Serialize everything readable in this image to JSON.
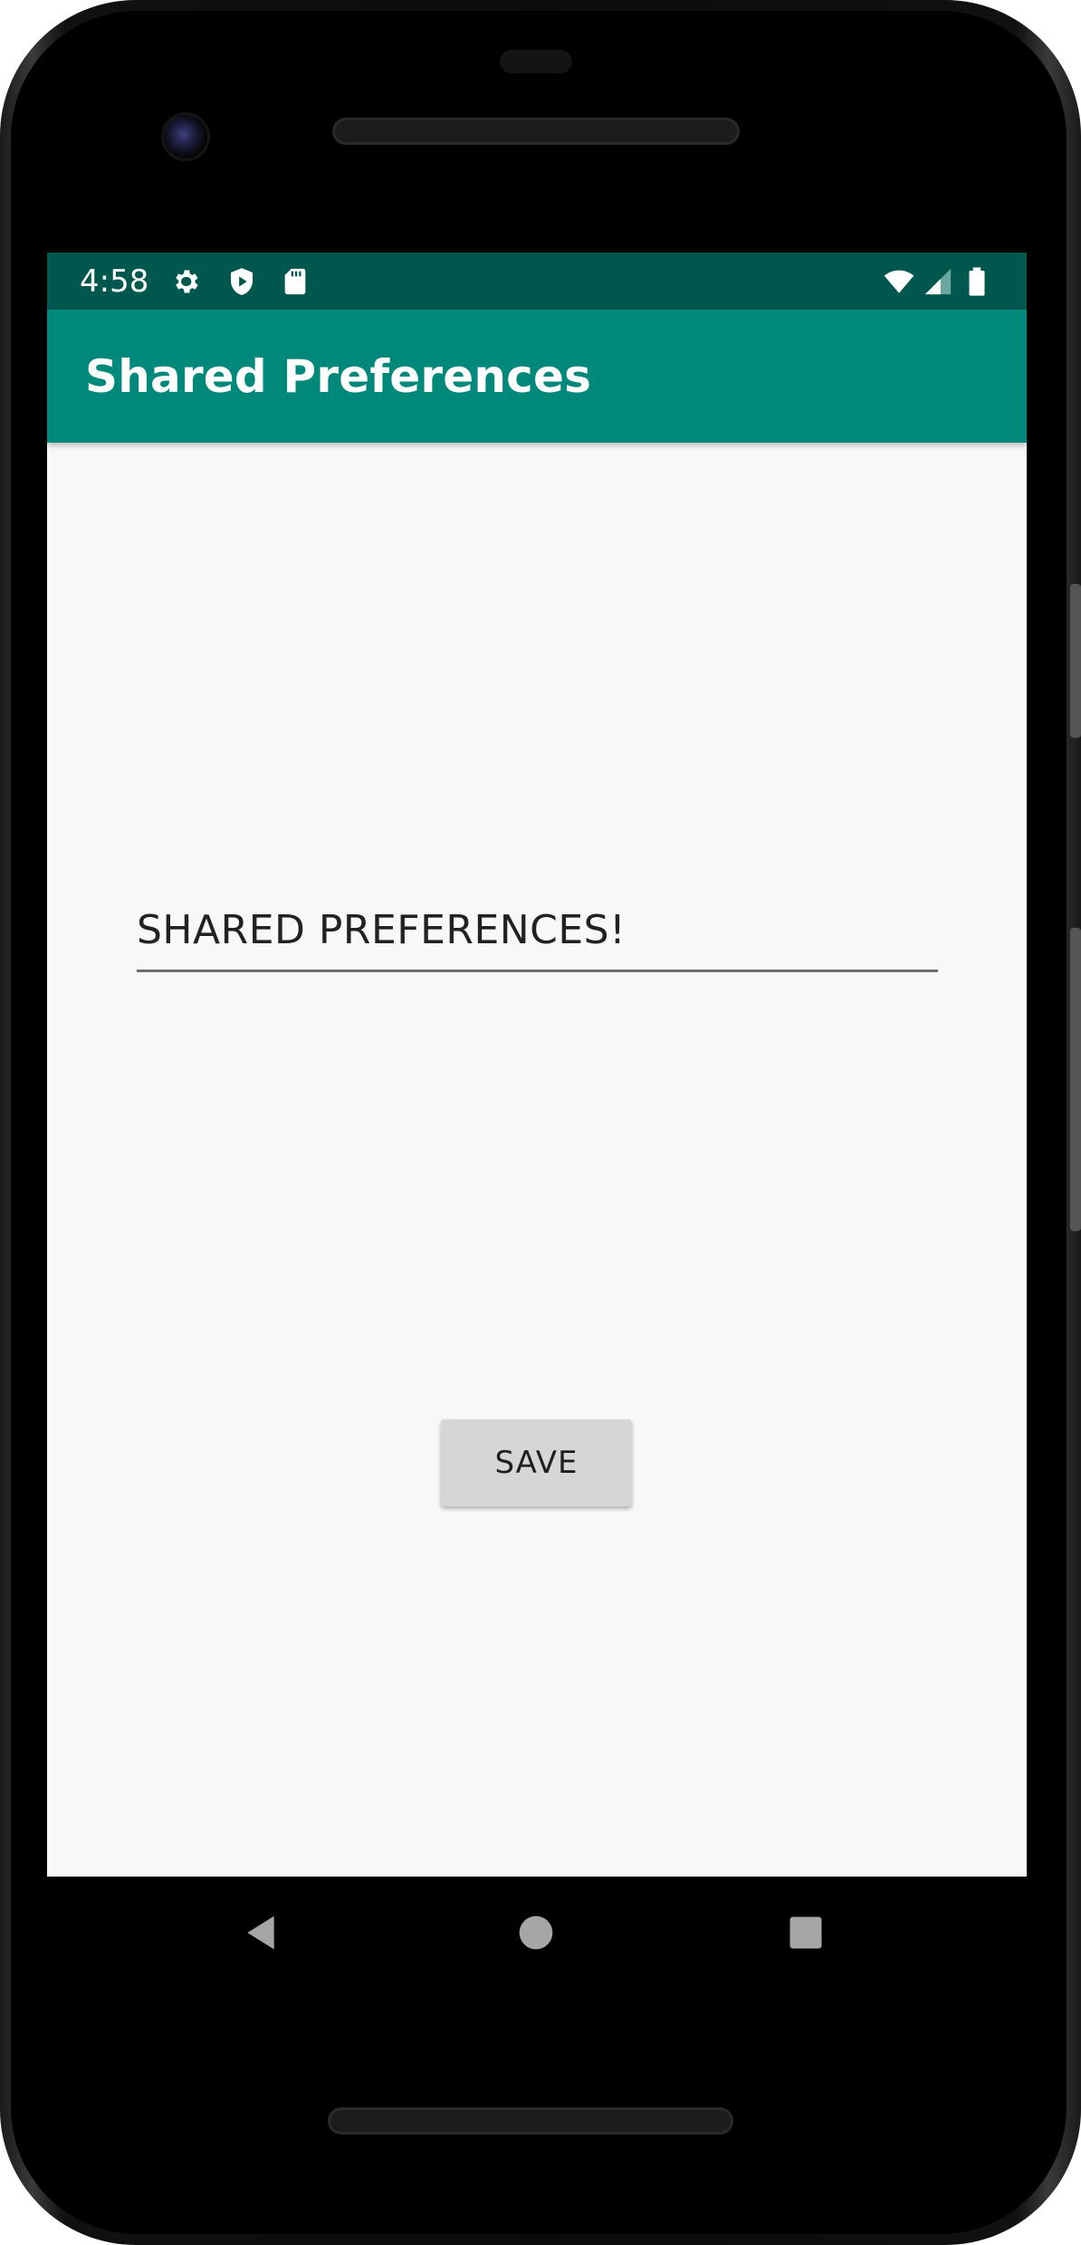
{
  "status_bar": {
    "time": "4:58",
    "left_icons": [
      "gear-icon",
      "shield-play-icon",
      "sd-card-icon"
    ],
    "right_icons": [
      "wifi-icon",
      "cell-signal-icon",
      "battery-icon"
    ],
    "background_color": "#00574d"
  },
  "app_bar": {
    "title": "Shared Preferences",
    "background_color": "#00897b"
  },
  "main": {
    "text_input": {
      "value": "SHARED PREFERENCES!",
      "placeholder": ""
    },
    "save_button": {
      "label": "SAVE"
    }
  },
  "nav_bar": {
    "buttons": [
      "back-icon",
      "home-icon",
      "recents-icon"
    ]
  }
}
